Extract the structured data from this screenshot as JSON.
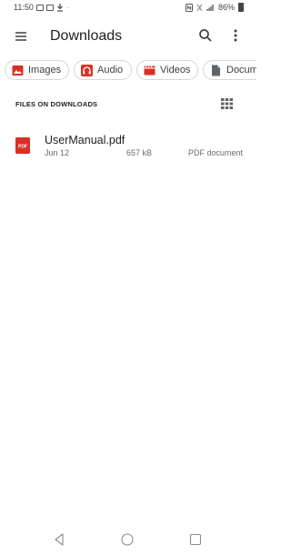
{
  "status_bar": {
    "time": "11:50",
    "battery": "86%"
  },
  "app_bar": {
    "title": "Downloads"
  },
  "chips": [
    {
      "label": "Images",
      "icon": "image-icon"
    },
    {
      "label": "Audio",
      "icon": "headphones-icon"
    },
    {
      "label": "Videos",
      "icon": "video-icon"
    },
    {
      "label": "Documents",
      "icon": "document-icon"
    }
  ],
  "section": {
    "header": "FILES ON DOWNLOADS"
  },
  "files": [
    {
      "name": "UserManual.pdf",
      "date": "Jun 12",
      "size": "657 kB",
      "type": "PDF document",
      "icon_label": "PDF"
    }
  ],
  "colors": {
    "accent": "#d93025",
    "text": "#202124",
    "secondary": "#6b6b6b"
  }
}
